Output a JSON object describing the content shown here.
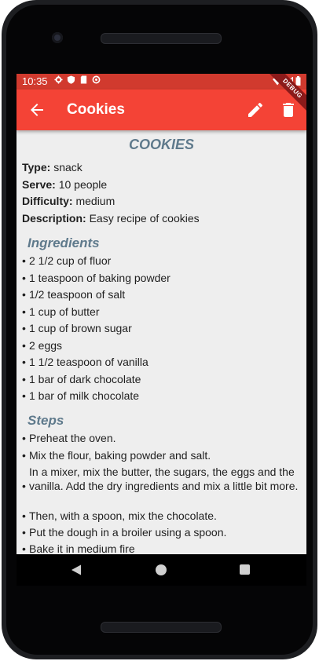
{
  "status_bar": {
    "time": "10:35"
  },
  "app_bar": {
    "title": "Cookies"
  },
  "debug_banner": "DEBUG",
  "recipe": {
    "title": "COOKIES",
    "type_label": "Type:",
    "type_value": "snack",
    "serve_label": "Serve:",
    "serve_value": "10 people",
    "difficulty_label": "Difficulty:",
    "difficulty_value": "medium",
    "description_label": "Description:",
    "description_value": "Easy recipe of cookies"
  },
  "ingredients": {
    "title": "Ingredients",
    "items": [
      "2 1/2 cup of fluor",
      "1 teaspoon of baking powder",
      "1/2 teaspoon of salt",
      "1 cup of butter",
      "1 cup of brown sugar",
      "2 eggs",
      "1 1/2 teaspoon of vanilla",
      "1 bar of dark chocolate",
      "1 bar of milk chocolate"
    ]
  },
  "steps": {
    "title": "Steps",
    "items": [
      "Preheat the oven.",
      "Mix the flour, baking powder and salt.",
      "In a mixer, mix the butter, the sugars, the eggs and the vanilla. Add the dry ingredients and mix a little bit more.",
      "Then, with a spoon, mix the chocolate.",
      "Put the dough in a broiler using a spoon.",
      "Bake it in medium fire"
    ]
  },
  "bullet_char": "•",
  "colors": {
    "app_bar": "#f44336",
    "status_bar": "#d13a2e",
    "section_title": "#5f7a8c",
    "background": "#eeeeee"
  }
}
